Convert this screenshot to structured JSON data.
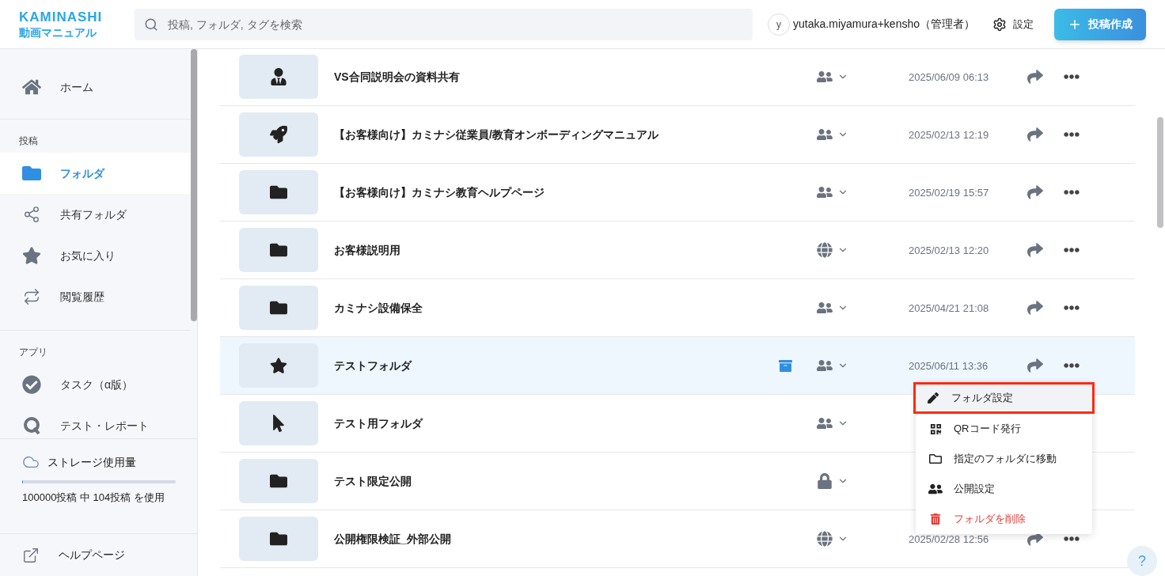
{
  "header": {
    "logo": {
      "brand": "KAMINASHI",
      "product": "動画マニュアル"
    },
    "search": {
      "placeholder": "投稿, フォルダ, タグを検索"
    },
    "user": {
      "avatar": "y",
      "name": "yutaka.miyamura+kensho（管理者）"
    },
    "settings": "設定",
    "create_button": "投稿作成"
  },
  "sidebar": {
    "items": [
      {
        "kind": "home",
        "label": "ホーム",
        "selected": false
      }
    ],
    "sections": [
      {
        "title": "投稿",
        "items": [
          {
            "kind": "folder",
            "label": "フォルダ",
            "selected": true
          },
          {
            "kind": "share",
            "label": "共有フォルダ",
            "selected": false
          },
          {
            "kind": "star",
            "label": "お気に入り",
            "selected": false
          },
          {
            "kind": "history",
            "label": "閲覧履歴",
            "selected": false
          }
        ]
      },
      {
        "title": "アプリ",
        "items": [
          {
            "kind": "task",
            "label": "タスク（α版）",
            "selected": false
          },
          {
            "kind": "test",
            "label": "テスト・レポート",
            "selected": false
          }
        ]
      }
    ],
    "storage": {
      "title": "ストレージ使用量",
      "level": 0.001,
      "usage": "100000投稿 中 104投稿 を使用"
    },
    "help": "ヘルプページ"
  },
  "folders": [
    {
      "thumbnail": {
        "kind": "person"
      },
      "name": "VS合同説明会の資料共有",
      "archived": false,
      "visibility": {
        "kind": "group"
      },
      "date": "2025/06/09 06:13",
      "selected": false
    },
    {
      "thumbnail": {
        "kind": "rocket"
      },
      "name": "【お客様向け】カミナシ従業員/教育オンボーディングマニュアル",
      "archived": false,
      "visibility": {
        "kind": "group"
      },
      "date": "2025/02/13 12:19",
      "selected": false
    },
    {
      "thumbnail": {
        "kind": "folder"
      },
      "name": "【お客様向け】カミナシ教育ヘルプページ",
      "archived": false,
      "visibility": {
        "kind": "group"
      },
      "date": "2025/02/19 15:57",
      "selected": false
    },
    {
      "thumbnail": {
        "kind": "folder"
      },
      "name": "お客様説明用",
      "archived": false,
      "visibility": {
        "kind": "globe"
      },
      "date": "2025/02/13 12:20",
      "selected": false
    },
    {
      "thumbnail": {
        "kind": "folder"
      },
      "name": "カミナシ設備保全",
      "archived": false,
      "visibility": {
        "kind": "group"
      },
      "date": "2025/04/21 21:08",
      "selected": false
    },
    {
      "thumbnail": {
        "kind": "star"
      },
      "name": "テストフォルダ",
      "archived": true,
      "visibility": {
        "kind": "group"
      },
      "date": "2025/06/11 13:36",
      "selected": true
    },
    {
      "thumbnail": {
        "kind": "cursor"
      },
      "name": "テスト用フォルダ",
      "archived": false,
      "visibility": {
        "kind": "group"
      },
      "selected": false
    },
    {
      "thumbnail": {
        "kind": "folder"
      },
      "name": "テスト限定公開",
      "archived": false,
      "visibility": {
        "kind": "lock"
      },
      "selected": false
    },
    {
      "thumbnail": {
        "kind": "folder"
      },
      "name": "公開権限検証_外部公開",
      "archived": false,
      "visibility": {
        "kind": "globe"
      },
      "date": "2025/02/28 12:56",
      "selected": false
    }
  ],
  "context_menu": {
    "items": [
      {
        "kind": "edit",
        "label": "フォルダ設定",
        "highlighted": true
      },
      {
        "kind": "qr",
        "label": "QRコード発行",
        "highlighted": false
      },
      {
        "kind": "move",
        "label": "指定のフォルダに移動",
        "highlighted": false
      },
      {
        "kind": "visibility",
        "label": "公開設定",
        "highlighted": false
      },
      {
        "kind": "delete",
        "label": "フォルダを削除",
        "highlighted": false
      }
    ]
  },
  "help_button": "?"
}
